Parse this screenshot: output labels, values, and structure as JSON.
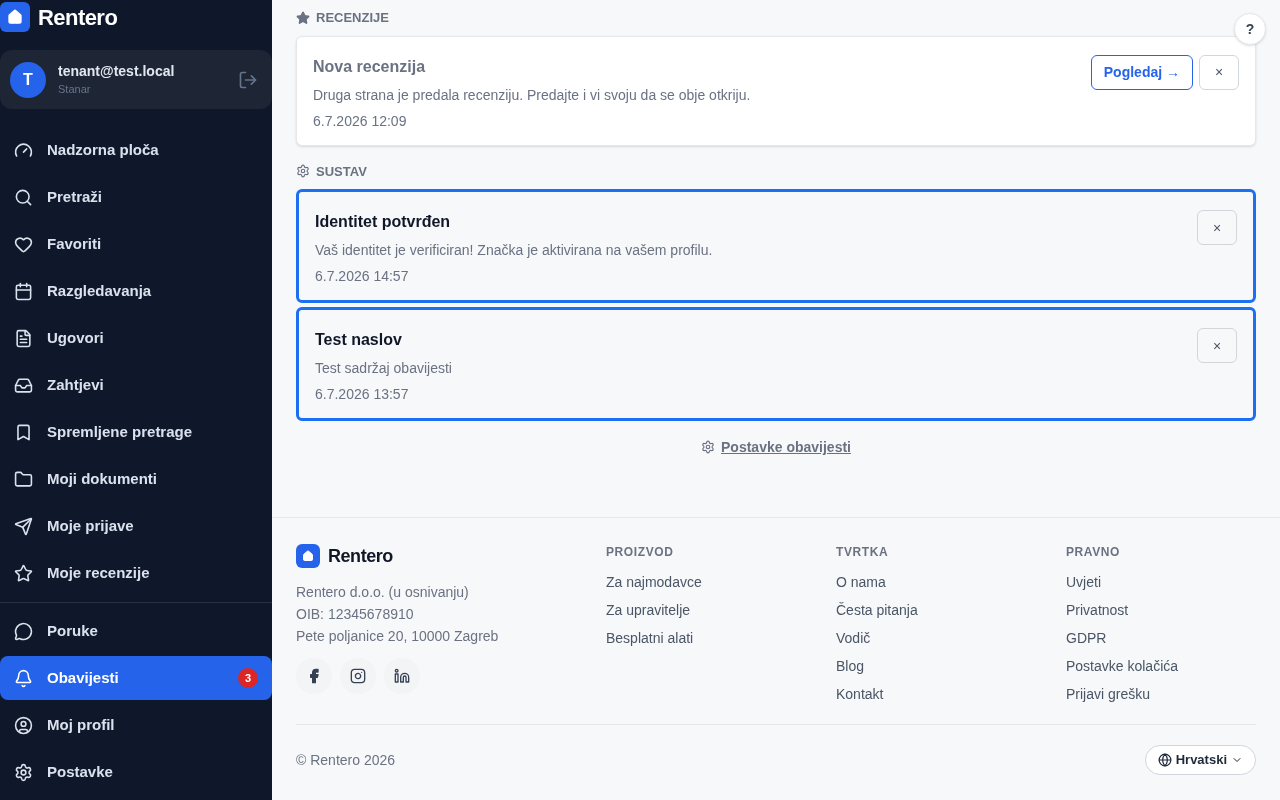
{
  "sidebar": {
    "brand": "Rentero",
    "user": {
      "initial": "T",
      "email": "tenant@test.local",
      "role": "Stanar"
    },
    "nav_groups": [
      [
        {
          "label": "Nadzorna ploča",
          "selected": false
        },
        {
          "label": "Pretraži",
          "selected": false
        },
        {
          "label": "Favoriti",
          "selected": false
        },
        {
          "label": "Razgledavanja",
          "selected": false
        },
        {
          "label": "Ugovori",
          "selected": false
        },
        {
          "label": "Zahtjevi",
          "selected": false
        },
        {
          "label": "Spremljene pretrage",
          "selected": false
        },
        {
          "label": "Moji dokumenti",
          "selected": false
        },
        {
          "label": "Moje prijave",
          "selected": false
        },
        {
          "label": "Moje recenzije",
          "selected": false
        }
      ],
      [
        {
          "label": "Poruke",
          "selected": false
        },
        {
          "label": "Obavijesti",
          "selected": true,
          "badge": "3"
        },
        {
          "label": "Moj profil",
          "selected": false
        },
        {
          "label": "Postavke",
          "selected": false
        }
      ]
    ]
  },
  "help_button": "?",
  "sections": [
    {
      "title": "RECENZIJE",
      "kind": "star",
      "notifications": [
        {
          "title": "Nova recenzija",
          "body": "Druga strana je predala recenziju. Predajte i vi svoju da se obje otkriju.",
          "time": "6.7.2026 12:09",
          "unread": false,
          "action": "Pogledaj →",
          "dismiss": "×"
        }
      ]
    },
    {
      "title": "SUSTAV",
      "kind": "gear",
      "notifications": [
        {
          "title": "Identitet potvrđen",
          "body": "Vaš identitet je verificiran! Značka je aktivirana na vašem profilu.",
          "time": "6.7.2026 14:57",
          "unread": true,
          "dismiss": "×"
        },
        {
          "title": "Test naslov",
          "body": "Test sadržaj obavijesti",
          "time": "6.7.2026 13:57",
          "unread": true,
          "dismiss": "×"
        }
      ]
    }
  ],
  "settings_link": "Postavke obavijesti",
  "footer": {
    "brand": "Rentero",
    "company": [
      "Rentero d.o.o. (u osnivanju)",
      "OIB: 12345678910",
      "Pete poljanice 20, 10000 Zagreb"
    ],
    "columns": [
      {
        "heading": "PROIZVOD",
        "links": [
          "Za najmodavce",
          "Za upravitelje",
          "Besplatni alati"
        ]
      },
      {
        "heading": "TVRTKA",
        "links": [
          "O nama",
          "Česta pitanja",
          "Vodič",
          "Blog",
          "Kontakt"
        ]
      },
      {
        "heading": "PRAVNO",
        "links": [
          "Uvjeti",
          "Privatnost",
          "GDPR",
          "Postavke kolačića",
          "Prijavi grešku"
        ]
      }
    ],
    "copyright": "© Rentero 2026",
    "language": "Hrvatski"
  }
}
